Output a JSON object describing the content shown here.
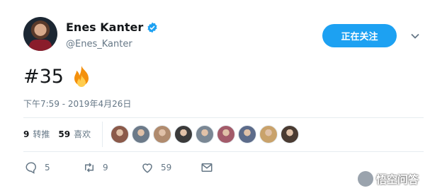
{
  "user": {
    "display_name": "Enes Kanter",
    "handle": "@Enes_Kanter",
    "verified": true,
    "avatar_icon": "user-avatar"
  },
  "follow_button": {
    "label": "正在关注"
  },
  "menu": {
    "icon": "chevron-down-icon"
  },
  "tweet": {
    "text": "#35",
    "emoji_icon": "fire-icon",
    "timestamp": "下午7:59 - 2019年4月26日"
  },
  "stats": {
    "retweets": {
      "count": "9",
      "label": "转推"
    },
    "likes": {
      "count": "59",
      "label": "喜欢"
    }
  },
  "likers": [
    {
      "color": "#8b5a4a"
    },
    {
      "color": "#6c7a89"
    },
    {
      "color": "#b08b6e"
    },
    {
      "color": "#3a3a3a"
    },
    {
      "color": "#7a8794"
    },
    {
      "color": "#a35b6a"
    },
    {
      "color": "#5c6b8a"
    },
    {
      "color": "#c9a26b"
    },
    {
      "color": "#4a3b32"
    }
  ],
  "actions": {
    "reply": {
      "count": "5",
      "icon": "reply-icon"
    },
    "retweet": {
      "count": "9",
      "icon": "retweet-icon"
    },
    "like": {
      "count": "59",
      "icon": "heart-icon"
    },
    "message": {
      "icon": "mail-icon"
    }
  },
  "watermark": {
    "text": "悟空问答"
  },
  "colors": {
    "accent": "#1da1f2",
    "muted": "#657786",
    "text": "#14171a"
  }
}
